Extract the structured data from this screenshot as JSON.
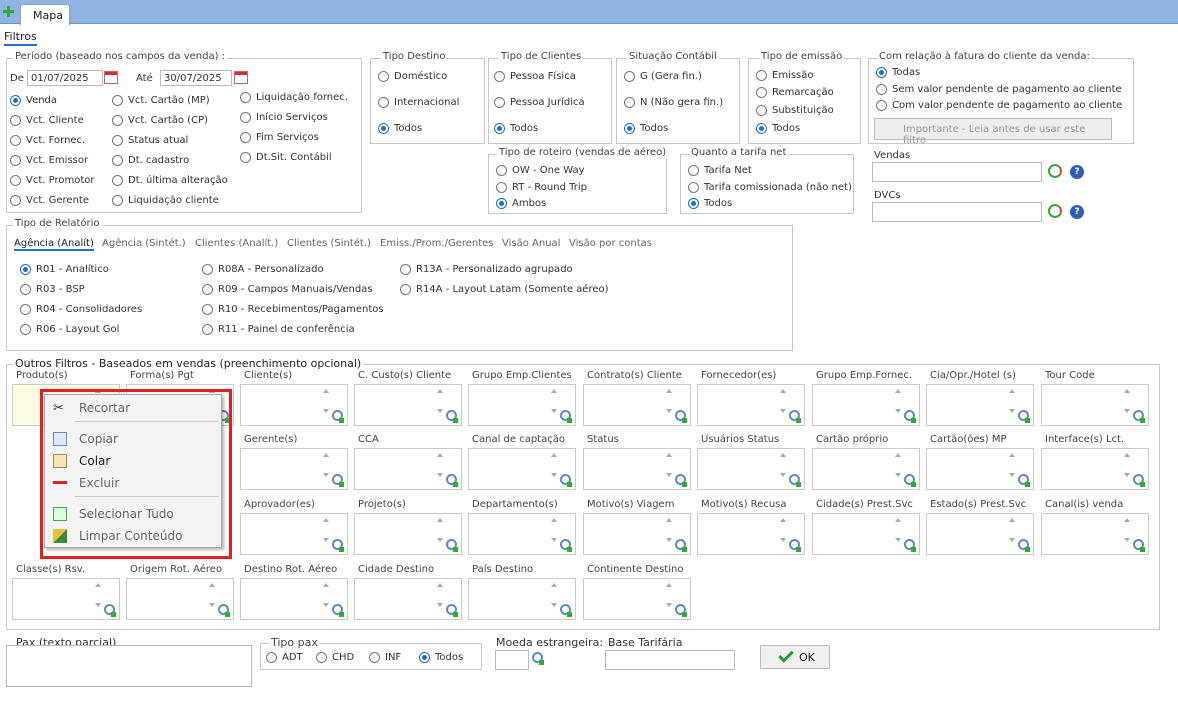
{
  "tab": {
    "label": "Mapa"
  },
  "filtros_label": "Filtros",
  "periodo": {
    "title": "Período (baseado nos campos da venda) :",
    "de": "De",
    "ate": "Até",
    "de_value": "01/07/2025",
    "ate_value": "30/07/2025",
    "options": [
      "Venda",
      "Vct. Cliente",
      "Vct. Fornec.",
      "Vct. Emissor",
      "Vct. Promotor",
      "Vct. Gerente",
      "Vct. Cartão (MP)",
      "Vct. Cartão (CP)",
      "Status atual",
      "Dt. cadastro",
      "Dt. última alteração",
      "Liquidação cliente",
      "Liquidação fornec.",
      "Início Serviços",
      "Fim Serviços",
      "Dt.Sit. Contábil"
    ]
  },
  "tipo_destino": {
    "title": "Tipo Destino",
    "options": [
      "Doméstico",
      "Internacional",
      "Todos"
    ]
  },
  "tipo_clientes": {
    "title": "Tipo de Clientes",
    "options": [
      "Pessoa Física",
      "Pessoa Jurídica",
      "Todos"
    ]
  },
  "situacao": {
    "title": "Situação Contábil",
    "options": [
      "G (Gera fin.)",
      "N (Não gera fin.)",
      "Todos"
    ]
  },
  "tipo_emissao": {
    "title": "Tipo de emissão",
    "options": [
      "Emissão",
      "Remarcação",
      "Substituição",
      "Todos"
    ]
  },
  "fatura": {
    "title": "Com relação à fatura do cliente da venda:",
    "options": [
      "Todas",
      "Sem valor pendente de pagamento ao cliente",
      "Com valor pendente de pagamento ao cliente"
    ],
    "important": "Importante - Leia antes de usar este filtro"
  },
  "roteiro": {
    "title": "Tipo de roteiro (vendas de aéreo)",
    "options": [
      "OW - One Way",
      "RT - Round Trip",
      "Ambos"
    ]
  },
  "tarifa": {
    "title": "Quanto a tarifa net",
    "options": [
      "Tarifa Net",
      "Tarifa comissionada (não net)",
      "Todos"
    ]
  },
  "vendas_label": "Vendas",
  "dvcs_label": "DVCs",
  "relatorio": {
    "title": "Tipo de Relatório",
    "subtabs": [
      "Agência (Analít)",
      "Agência (Sintét.)",
      "Clientes (Analít.)",
      "Clientes (Sintét.)",
      "Emiss./Prom./Gerentes",
      "Visão Anual",
      "Visão por contas"
    ],
    "options": [
      "R01 - Analítico",
      "R03 - BSP",
      "R04 - Consolidadores",
      "R06 - Layout Gol",
      "R08A - Personalizado",
      "R09 - Campos Manuais/Vendas",
      "R10 - Recebimentos/Pagamentos",
      "R11 - Painel de conferência",
      "R13A - Personalizado agrupado",
      "R14A - Layout Latam (Somente aéreo)"
    ]
  },
  "outros": {
    "title": "Outros Filtros - Baseados em vendas (preenchimento opcional)",
    "row1": [
      "Produto(s)",
      "Forma(s) Pgt",
      "Cliente(s)",
      "C. Custo(s) Cliente",
      "Grupo Emp.Clientes",
      "Contrato(s) Cliente",
      "Fornecedor(es)",
      "Grupo Emp.Fornec.",
      "Cia/Opr./Hotel (s)",
      "Tour Code"
    ],
    "row2": [
      "Emiss",
      "",
      "Gerente(s)",
      "CCA",
      "Canal de captação",
      "Status",
      "Usuários Status",
      "Cartão próprio",
      "Cartão(ões) MP",
      "Interface(s) Lct."
    ],
    "row3": [
      "Nr. R",
      "",
      "Aprovador(es)",
      "Projeto(s)",
      "Departamento(s)",
      "Motivo(s) Viagem",
      "Motivo(s) Recusa",
      "Cidade(s) Prest.Svc",
      "Estado(s) Prest.Svc",
      "Canal(is) venda"
    ],
    "row4": [
      "Classe(s) Rsv.",
      "Origem Rot. Aéreo",
      "Destino Rot. Aéreo",
      "Cidade Destino",
      "País Destino",
      "Continente Destino"
    ]
  },
  "context_menu": {
    "items": [
      "Recortar",
      "Copiar",
      "Colar",
      "Excluir",
      "Selecionar Tudo",
      "Limpar Conteúdo"
    ]
  },
  "pax": {
    "title": "Pax (texto parcial)"
  },
  "tipo_pax": {
    "title": "Tipo pax",
    "options": [
      "ADT",
      "CHD",
      "INF",
      "Todos"
    ]
  },
  "moeda": "Moeda estrangeira:",
  "base": "Base Tarifária",
  "ok": "OK"
}
